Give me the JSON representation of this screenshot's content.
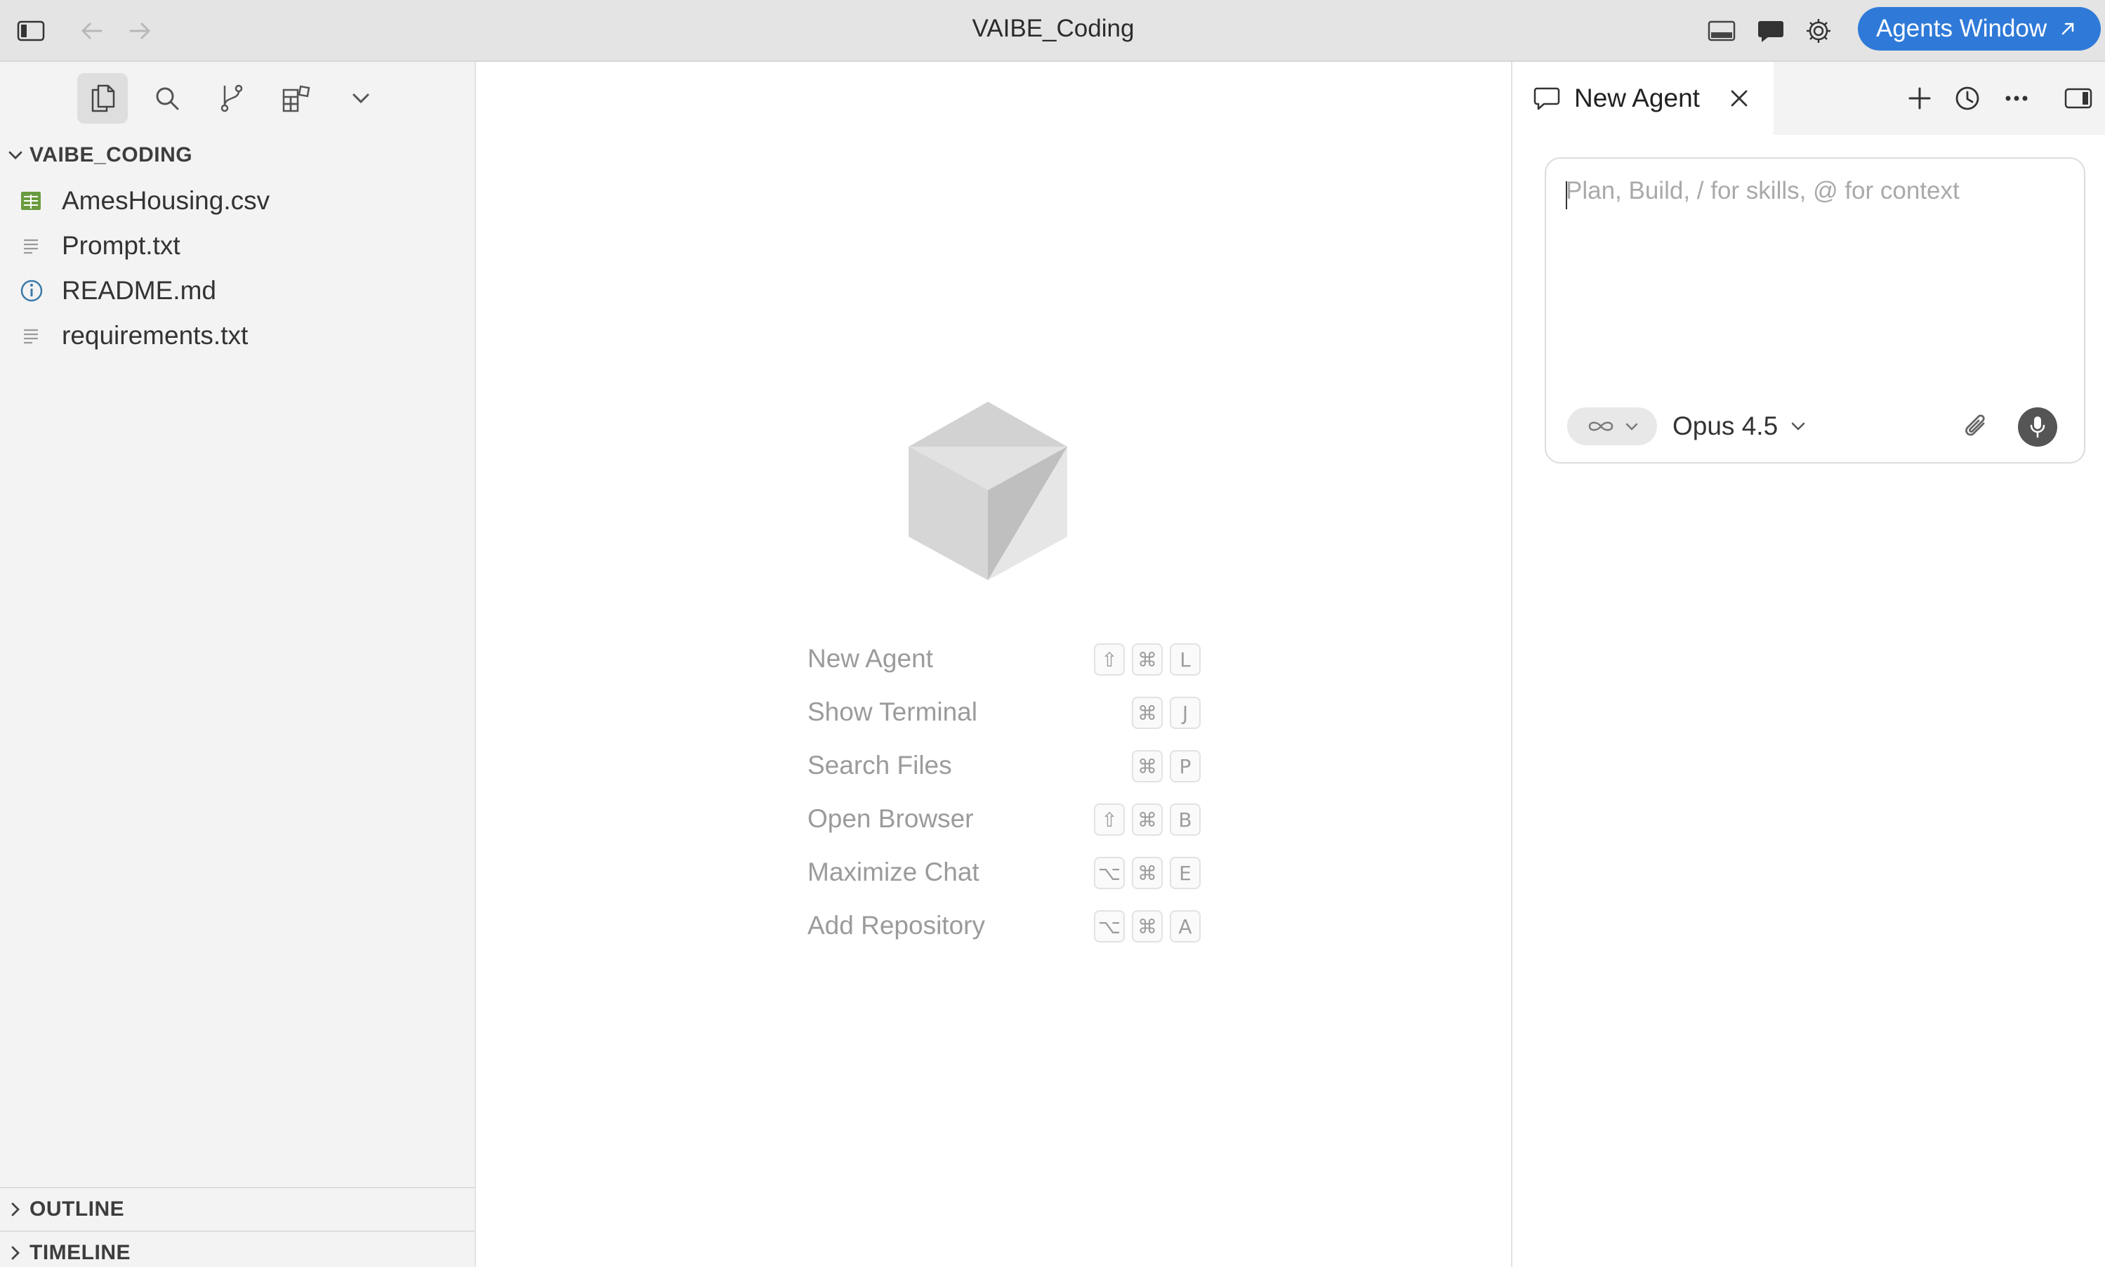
{
  "titlebar": {
    "window_title": "VAIBE_Coding",
    "agents_button_label": "Agents Window",
    "icons": [
      "sidebar-toggle-icon",
      "back-arrow-icon",
      "forward-arrow-icon",
      "panel-layout-icon",
      "chat-bubble-icon",
      "gear-icon",
      "external-arrow-icon"
    ]
  },
  "sidebar": {
    "toolbar_icons": [
      "files-icon",
      "search-icon",
      "source-control-icon",
      "extensions-icon",
      "chevron-down-icon"
    ],
    "root_folder": "VAIBE_CODING",
    "files": [
      {
        "name": "AmesHousing.csv",
        "icon": "csv-table-icon"
      },
      {
        "name": "Prompt.txt",
        "icon": "text-file-icon"
      },
      {
        "name": "README.md",
        "icon": "info-icon"
      },
      {
        "name": "requirements.txt",
        "icon": "text-file-icon"
      }
    ],
    "sections": [
      "OUTLINE",
      "TIMELINE"
    ]
  },
  "center": {
    "logo": "cube-logo",
    "shortcuts": [
      {
        "label": "New Agent",
        "keys": [
          "⇧",
          "⌘",
          "L"
        ]
      },
      {
        "label": "Show Terminal",
        "keys": [
          "",
          "⌘",
          "J"
        ]
      },
      {
        "label": "Search Files",
        "keys": [
          "",
          "⌘",
          "P"
        ]
      },
      {
        "label": "Open Browser",
        "keys": [
          "⇧",
          "⌘",
          "B"
        ]
      },
      {
        "label": "Maximize Chat",
        "keys": [
          "⌥",
          "⌘",
          "E"
        ]
      },
      {
        "label": "Add Repository",
        "keys": [
          "⌥",
          "⌘",
          "A"
        ]
      }
    ]
  },
  "agent_panel": {
    "tab_label": "New Agent",
    "icons": [
      "chat-bubble-outline-icon",
      "close-icon",
      "plus-icon",
      "history-clock-icon",
      "more-dots-icon",
      "right-panel-toggle-icon"
    ],
    "input_placeholder": "Plan, Build, / for skills, @ for context",
    "input_value": "",
    "mode_icon": "infinity-icon",
    "model_label": "Opus 4.5"
  },
  "colors": {
    "titlebar_bg": "#e4e4e4",
    "sidebar_bg": "#f3f3f3",
    "accent": "#2f7ad8",
    "csv_icon": "#6a9b3f",
    "info_icon": "#3b7aa8"
  }
}
